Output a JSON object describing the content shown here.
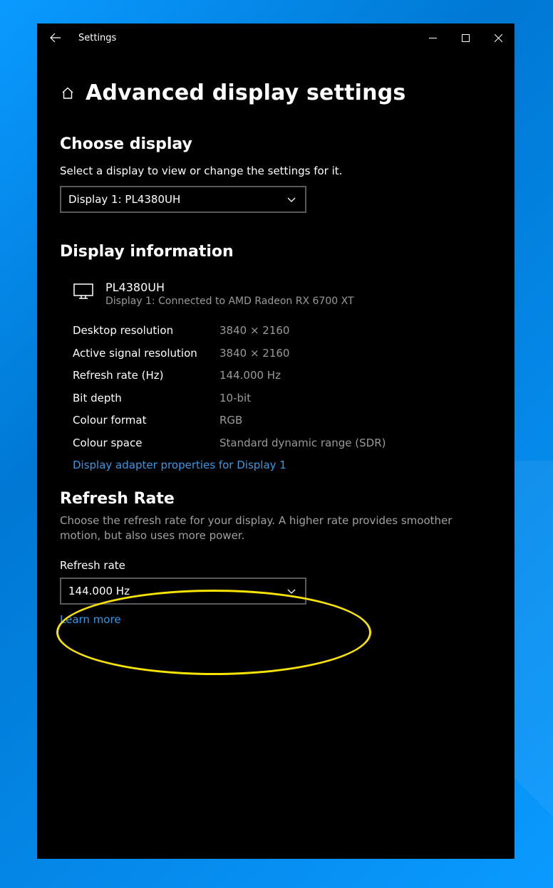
{
  "titlebar": {
    "title": "Settings"
  },
  "header": {
    "page_title": "Advanced display settings"
  },
  "choose_display": {
    "heading": "Choose display",
    "subtext": "Select a display to view or change the settings for it.",
    "selected": "Display 1: PL4380UH"
  },
  "display_info": {
    "heading": "Display information",
    "name": "PL4380UH",
    "connection": "Display 1: Connected to AMD Radeon RX 6700 XT",
    "rows": [
      {
        "key": "Desktop resolution",
        "val": "3840 × 2160"
      },
      {
        "key": "Active signal resolution",
        "val": "3840 × 2160"
      },
      {
        "key": "Refresh rate (Hz)",
        "val": "144.000 Hz"
      },
      {
        "key": "Bit depth",
        "val": "10-bit"
      },
      {
        "key": "Colour format",
        "val": "RGB"
      },
      {
        "key": "Colour space",
        "val": "Standard dynamic range (SDR)"
      }
    ],
    "adapter_link": "Display adapter properties for Display 1"
  },
  "refresh_rate": {
    "heading": "Refresh Rate",
    "help": "Choose the refresh rate for your display. A higher rate provides smoother motion, but also uses more power.",
    "field_label": "Refresh rate",
    "selected": "144.000 Hz",
    "learn_more": "Learn more"
  }
}
